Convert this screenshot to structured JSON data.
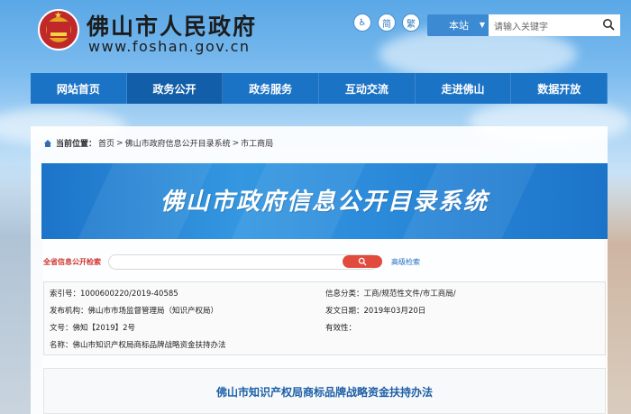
{
  "header": {
    "site_title": "佛山市人民政府",
    "site_url": "www.foshan.gov.cn",
    "tools": [
      {
        "name": "accessibility-icon",
        "glyph": "♿"
      },
      {
        "name": "simplified-icon",
        "label": "简"
      },
      {
        "name": "traditional-icon",
        "label": "繁"
      }
    ],
    "site_select": "本站",
    "search_placeholder": "请输入关键字"
  },
  "nav": {
    "items": [
      {
        "label": "网站首页"
      },
      {
        "label": "政务公开",
        "active": true
      },
      {
        "label": "政务服务"
      },
      {
        "label": "互动交流"
      },
      {
        "label": "走进佛山"
      },
      {
        "label": "数据开放"
      }
    ]
  },
  "breadcrumb": {
    "prefix": "当前位置：",
    "items": [
      "首页",
      ">",
      "佛山市政府信息公开目录系统",
      ">",
      "市工商局"
    ]
  },
  "banner": {
    "title": "佛山市政府信息公开目录系统"
  },
  "info_search": {
    "label": "全省信息公开检索",
    "advanced": "高级检索"
  },
  "meta": {
    "index_no": "索引号：1000600220/2019-40585",
    "category": "信息分类：工商/规范性文件/市工商局/",
    "publisher": "发布机构：佛山市市场监督管理局（知识产权局）",
    "date": "发文日期：2019年03月20日",
    "doc_no": "文号：佛知【2019】2号",
    "validity": "有效性：",
    "name": "名称：佛山市知识产权局商标品牌战略资金扶持办法"
  },
  "document": {
    "title": "佛山市知识产权局商标品牌战略资金扶持办法"
  },
  "colors": {
    "nav_bg": "#1b73c6",
    "nav_active": "#135ea8",
    "banner_bg": "#2d8ddc",
    "search_red": "#e14b3e",
    "label_red": "#d2352e",
    "link_blue": "#1c6cc2"
  }
}
